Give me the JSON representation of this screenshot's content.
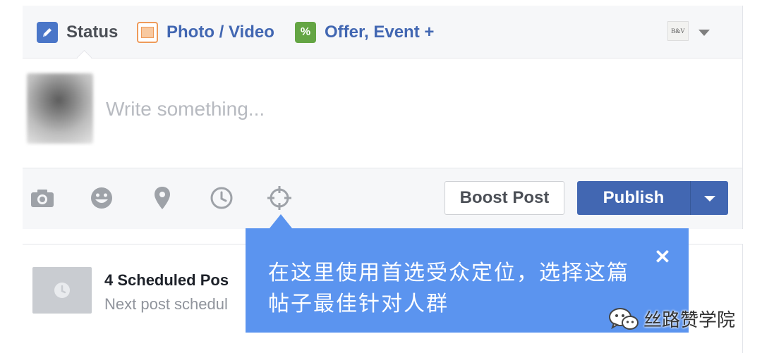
{
  "composer": {
    "tabs": [
      {
        "label": "Status",
        "icon": "pencil-icon"
      },
      {
        "label": "Photo / Video",
        "icon": "photo-icon"
      },
      {
        "label": "Offer, Event +",
        "icon": "offer-icon"
      }
    ],
    "page_avatar_text": "B&V",
    "input_placeholder": "Write something...",
    "toolbar_icons": [
      "camera-icon",
      "emoji-icon",
      "location-pin-icon",
      "clock-icon",
      "crosshair-icon"
    ],
    "boost_label": "Boost Post",
    "publish_label": "Publish"
  },
  "scheduled": {
    "title": "4 Scheduled Pos",
    "subtitle": "Next post schedul"
  },
  "tooltip": {
    "text": "在这里使用首选受众定位，选择这篇帖子最佳针对人群",
    "close_symbol": "✕"
  },
  "watermark": {
    "text": "丝路赞学院"
  },
  "colors": {
    "brand_blue": "#4267b2",
    "tooltip_blue": "#5b94ef",
    "offer_green": "#64a544",
    "photo_orange": "#ee9a5a"
  }
}
